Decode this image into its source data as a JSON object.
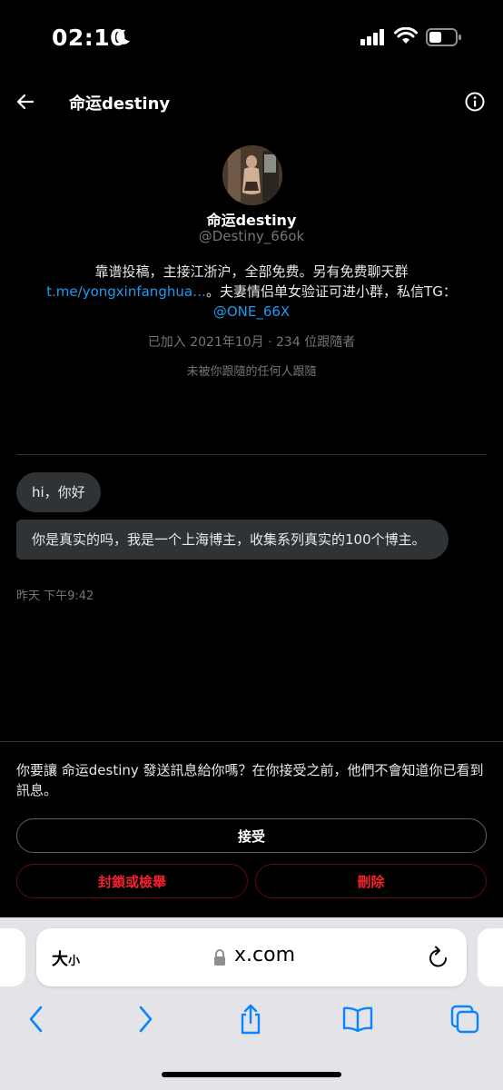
{
  "status_bar": {
    "time": "02:10"
  },
  "header": {
    "title": "命运destiny"
  },
  "profile": {
    "name": "命运destiny",
    "handle": "@Destiny_66ok",
    "bio_line1": "靠谱投稿，主接江浙沪，全部免费。另有免费聊天群",
    "bio_link": "t.me/yongxinfanghua…",
    "bio_line2_rest": "。夫妻情侣单女验证可进小群，私信TG：",
    "bio_mention": "@ONE_66X",
    "meta": "已加入 2021年10月 · 234 位跟隨者",
    "follow_note": "未被你跟隨的任何人跟隨"
  },
  "messages": [
    {
      "text": "hi，你好"
    },
    {
      "text": "你是真实的吗，我是一个上海博主，收集系列真实的100个博主。"
    }
  ],
  "message_time": "昨天 下午9:42",
  "request": {
    "text": "你要讓 命运destiny 發送訊息給你嗎？在你接受之前，他們不會知道你已看到訊息。",
    "accept_label": "接受",
    "block_label": "封鎖或檢舉",
    "delete_label": "刪除"
  },
  "safari": {
    "text_size_big": "大",
    "text_size_small": "小",
    "url": "x.com"
  },
  "colors": {
    "background": "#000000",
    "link": "#1d9bf0",
    "danger": "#f4212e",
    "bubble": "#2f3336",
    "muted": "#71767b"
  },
  "icons": [
    "moon-icon",
    "signal-icon",
    "wifi-icon",
    "battery-icon",
    "back-arrow-icon",
    "info-icon",
    "lock-icon",
    "reload-icon",
    "chevron-left-icon",
    "chevron-right-icon",
    "share-icon",
    "bookmarks-icon",
    "tabs-icon"
  ]
}
